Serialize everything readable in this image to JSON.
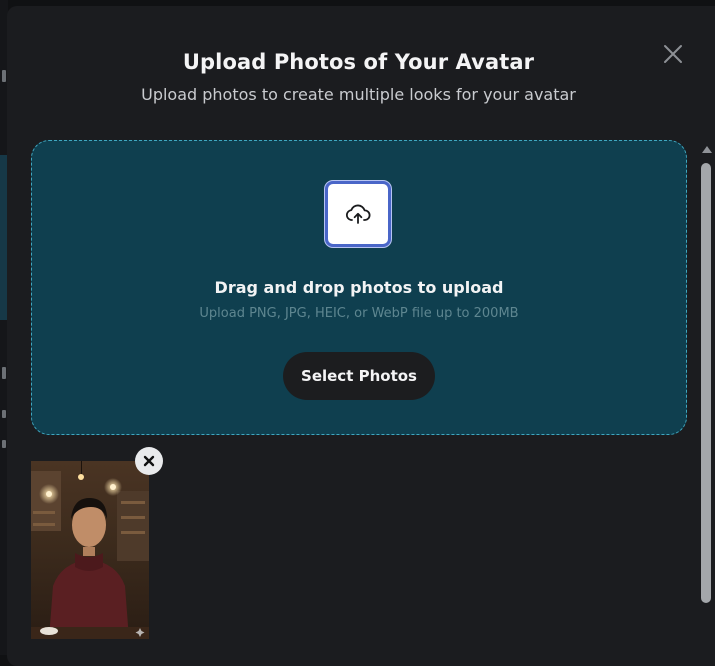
{
  "modal": {
    "title": "Upload Photos of Your Avatar",
    "subtitle": "Upload photos to create multiple looks for your avatar"
  },
  "dropzone": {
    "title": "Drag and drop photos to upload",
    "hint": "Upload PNG, JPG, HEIC, or WebP file up to 200MB",
    "select_label": "Select Photos",
    "icon": "cloud-upload-icon"
  },
  "uploads": [
    {
      "description_icon": "photo-thumbnail"
    }
  ],
  "colors": {
    "modal_bg": "#1b1c1f",
    "dropzone_bg": "#0f3f4f",
    "dropzone_border": "#3fa7c0",
    "button_bg": "#1c1d1f"
  }
}
